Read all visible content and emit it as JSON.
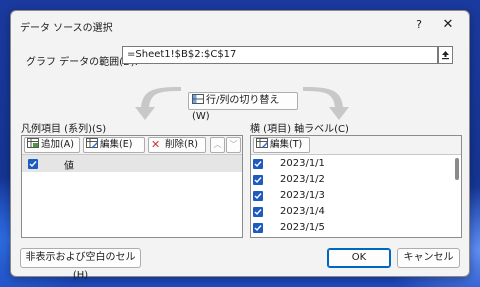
{
  "dialog": {
    "title": "データ ソースの選択",
    "help": "?",
    "close": "✕"
  },
  "range": {
    "label": "グラフ データの範囲(D):",
    "value": "=Sheet1!$B$2:$C$17"
  },
  "switch": {
    "label": "行/列の切り替え(W)"
  },
  "series_panel": {
    "label": "凡例項目 (系列)(S)",
    "add": "追加(A)",
    "edit": "編集(E)",
    "remove": "削除(R)",
    "up": "︿",
    "down": "﹀",
    "items": [
      {
        "label": "値",
        "checked": true,
        "selected": true
      }
    ]
  },
  "category_panel": {
    "label": "横 (項目) 軸ラベル(C)",
    "edit": "編集(T)",
    "items": [
      {
        "label": "2023/1/1",
        "checked": true
      },
      {
        "label": "2023/1/2",
        "checked": true
      },
      {
        "label": "2023/1/3",
        "checked": true
      },
      {
        "label": "2023/1/4",
        "checked": true
      },
      {
        "label": "2023/1/5",
        "checked": true
      }
    ]
  },
  "footer": {
    "hidden_cells": "非表示および空白のセル(H)",
    "ok": "OK",
    "cancel": "キャンセル"
  },
  "colors": {
    "accent": "#1c5bc1",
    "selection": "#e5e5e5",
    "wallpaper": "#1a3aa0"
  },
  "icons": [
    "help-icon",
    "close-icon",
    "collapse-range-icon",
    "switch-arrow-icon",
    "add-icon",
    "edit-icon",
    "delete-icon",
    "up-icon",
    "down-icon"
  ]
}
